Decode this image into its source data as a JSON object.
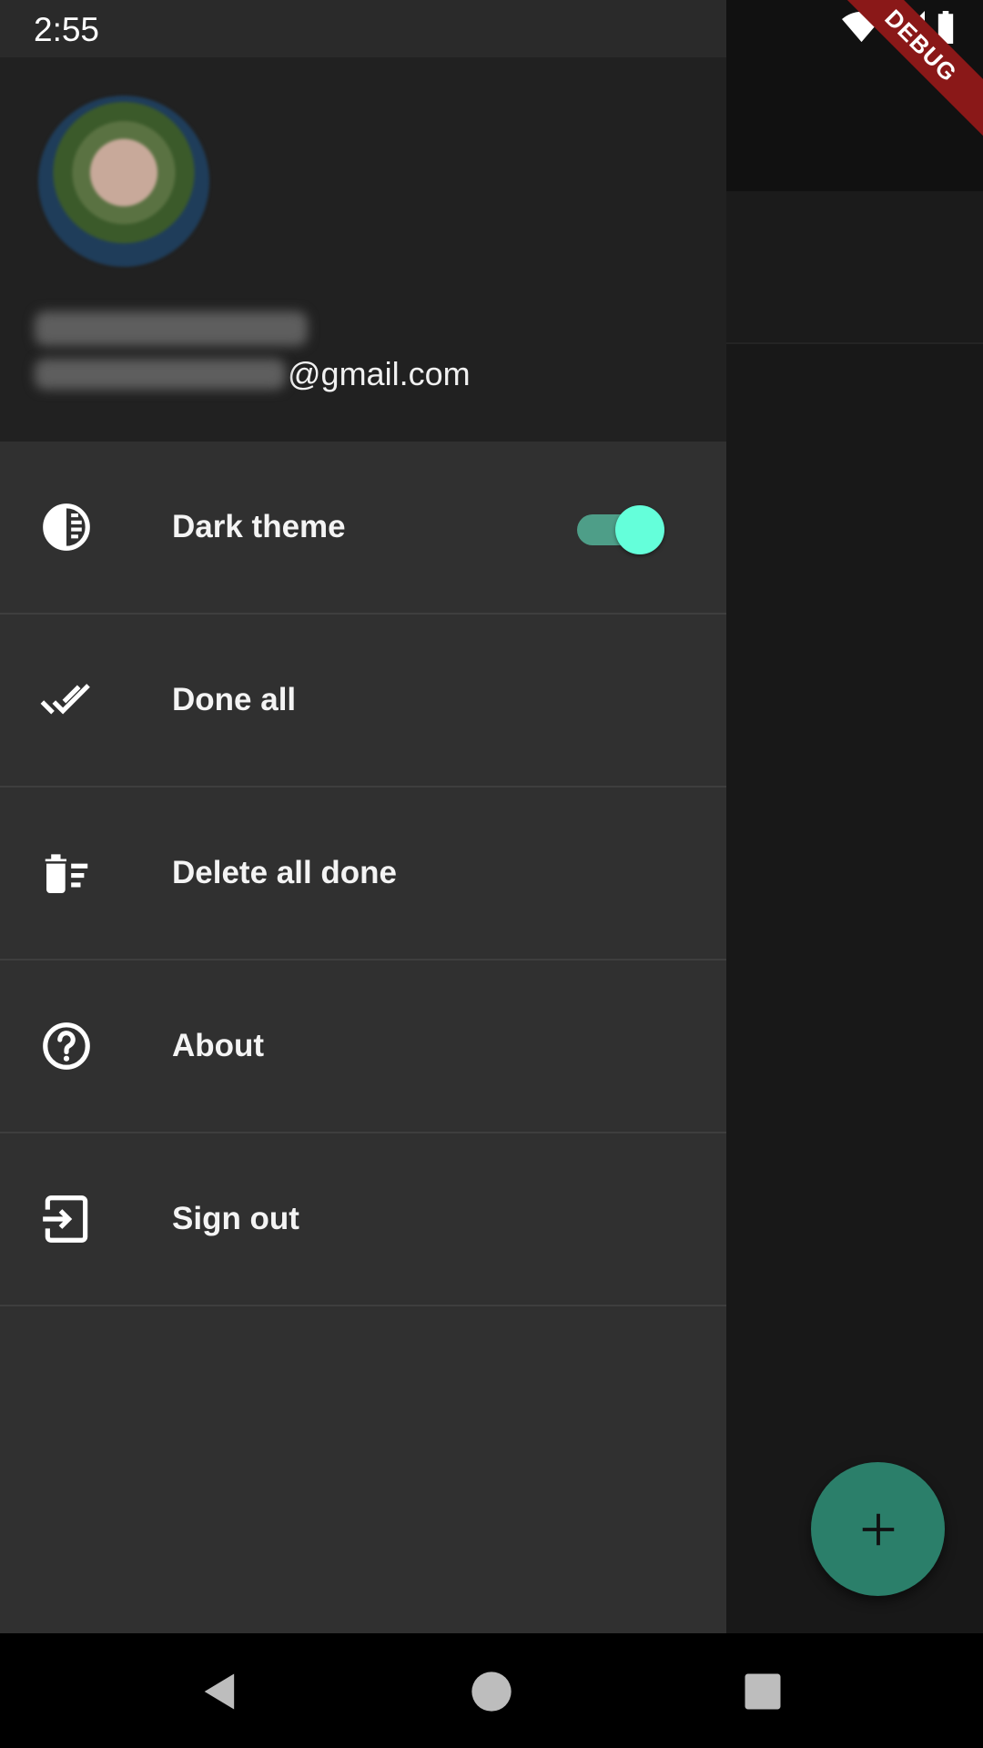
{
  "status_bar": {
    "time": "2:55",
    "icons": [
      "wifi-icon",
      "signal-icon",
      "battery-icon"
    ]
  },
  "debug_banner": "DEBUG",
  "drawer": {
    "header": {
      "email_domain": "@gmail.com"
    },
    "items": [
      {
        "label": "Dark theme",
        "icon": "theme-icon",
        "toggle": true
      },
      {
        "label": "Done all",
        "icon": "done-all-icon"
      },
      {
        "label": "Delete all done",
        "icon": "delete-sweep-icon"
      },
      {
        "label": "About",
        "icon": "help-icon"
      },
      {
        "label": "Sign out",
        "icon": "sign-out-icon"
      }
    ]
  },
  "fab": {
    "icon": "plus-icon"
  },
  "nav_bar": {
    "icons": [
      "back-icon",
      "home-icon",
      "recents-icon"
    ]
  },
  "colors": {
    "accent": "#64ffda",
    "fab": "#2b7f6a",
    "debug": "#8a1818"
  }
}
